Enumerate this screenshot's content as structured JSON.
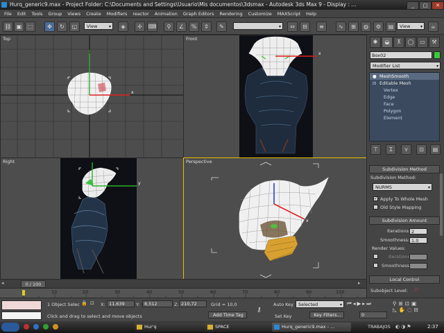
{
  "window": {
    "title": "Hurq_generic9.max     - Project Folder: C:\\Documents and Settings\\Usuario\\Mis documentos\\3dsmax      - Autodesk 3ds Max 9      - Display : ...",
    "minimize": "_",
    "maximize": "□",
    "close": "✕"
  },
  "menu": [
    "File",
    "Edit",
    "Tools",
    "Group",
    "Views",
    "Create",
    "Modifiers",
    "reactor",
    "Animation",
    "Graph Editors",
    "Rendering",
    "Customize",
    "MAXScript",
    "Help"
  ],
  "toolbar": {
    "selection_filter": "View",
    "coordinate_system": "View",
    "named_selection": ""
  },
  "viewports": {
    "top": "Top",
    "front": "Front",
    "right": "Right",
    "perspective": "Perspective"
  },
  "command_panel": {
    "object_name": "Box02",
    "object_color": "#3cc83c",
    "modifier_list": "Modifier List",
    "stack": {
      "meshsmooth": "MeshSmooth",
      "editable_mesh": "Editable Mesh",
      "vertex": "Vertex",
      "edge": "Edge",
      "face": "Face",
      "polygon": "Polygon",
      "element": "Element"
    },
    "subdivision": {
      "rollout_title": "Subdivision Method",
      "method_label": "Subdivision Method:",
      "method_value": "NURMS",
      "apply_whole_mesh": "Apply To Whole Mesh",
      "apply_checked": true,
      "old_style_mapping": "Old Style Mapping",
      "old_style_checked": false
    },
    "subdivision_amount": {
      "rollout_title": "Subdivision Amount",
      "iterations_label": "Iterations:",
      "iterations_value": "2",
      "smoothness_label": "Smoothness:",
      "smoothness_value": "1.0",
      "render_values_label": "Render Values:",
      "render_iterations_label": "Iterations:",
      "render_iterations_value": "0",
      "render_smoothness_label": "Smoothness:",
      "render_smoothness_value": "1.0"
    },
    "local_control": {
      "rollout_title": "Local Control",
      "subobject_level_label": "Subobject Level:"
    }
  },
  "timeline": {
    "frame_readout": "0 / 100",
    "ticks": [
      "10",
      "20",
      "30",
      "40",
      "50",
      "60",
      "70",
      "80",
      "90",
      "100"
    ]
  },
  "status": {
    "selection_count": "1 Object Selec",
    "x_label": "X:",
    "x_value": "11,639",
    "y_label": "Y:",
    "y_value": "8,512",
    "z_label": "Z:",
    "z_value": "210,72",
    "grid": "Grid = 10,0",
    "auto_key": "Auto Key",
    "set_key": "Set Key",
    "key_mode": "Selected",
    "key_filters": "Key Filters...",
    "add_time_tag": "Add Time Tag",
    "prompt": "Click and drag to select and move objects",
    "current_frame": "0"
  },
  "taskbar": {
    "items": [
      "Hur'q",
      "SPACE",
      "Hurq_generic9.max - ..."
    ],
    "tray_label": "TRABAJOS",
    "clock": "2:37"
  }
}
